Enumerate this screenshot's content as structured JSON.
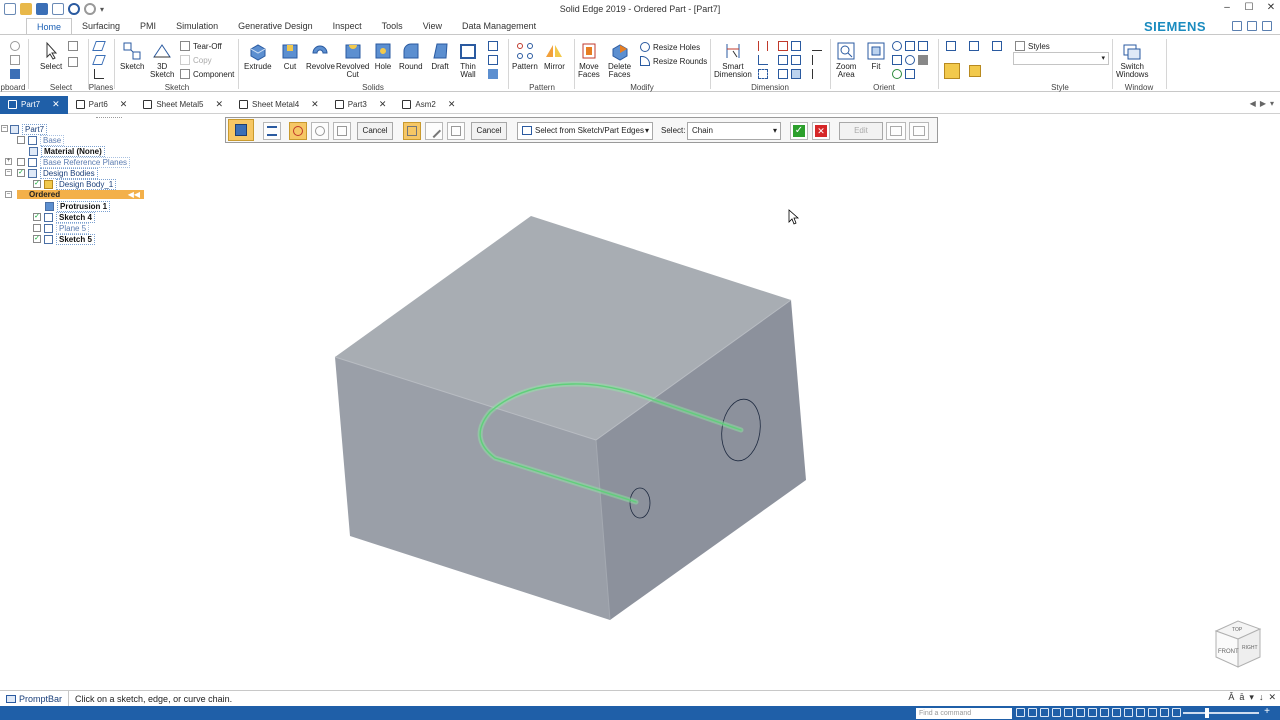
{
  "window": {
    "title": "Solid Edge 2019 - Ordered Part - [Part7]",
    "brand": "SIEMENS",
    "controls": [
      "–",
      "☐",
      "✕"
    ]
  },
  "ribbon_tabs": [
    {
      "label": "Home",
      "active": true
    },
    {
      "label": "Surfacing"
    },
    {
      "label": "PMI"
    },
    {
      "label": "Simulation"
    },
    {
      "label": "Generative Design"
    },
    {
      "label": "Inspect"
    },
    {
      "label": "Tools"
    },
    {
      "label": "View"
    },
    {
      "label": "Data Management"
    }
  ],
  "ribbon": {
    "clipboard_group": "pboard",
    "select": {
      "label": "Select",
      "group": "Select"
    },
    "planes_group": "Planes",
    "sketch": {
      "sketch": "Sketch",
      "sketch3d_1": "3D",
      "sketch3d_2": "Sketch",
      "tearoff": "Tear-Off",
      "copy": "Copy",
      "component": "Component",
      "group": "Sketch"
    },
    "solids": {
      "extrude": "Extrude",
      "cut": "Cut",
      "revolve": "Revolve",
      "revolved_cut_1": "Revolved",
      "revolved_cut_2": "Cut",
      "hole": "Hole",
      "round": "Round",
      "draft": "Draft",
      "thin_wall_1": "Thin",
      "thin_wall_2": "Wall",
      "group": "Solids"
    },
    "pattern": {
      "pattern": "Pattern",
      "mirror": "Mirror",
      "group": "Pattern"
    },
    "modify": {
      "move_faces_1": "Move",
      "move_faces_2": "Faces",
      "delete_faces_1": "Delete",
      "delete_faces_2": "Faces",
      "resize_holes": "Resize Holes",
      "resize_rounds": "Resize Rounds",
      "group": "Modify"
    },
    "dimension": {
      "smart_1": "Smart",
      "smart_2": "Dimension",
      "group": "Dimension"
    },
    "orient": {
      "zoom_area_1": "Zoom",
      "zoom_area_2": "Area",
      "fit": "Fit",
      "group": "Orient"
    },
    "style": {
      "styles": "Styles",
      "group": "Style"
    },
    "window_group": {
      "switch_1": "Switch",
      "switch_2": "Windows",
      "group": "Window"
    }
  },
  "doc_tabs": [
    {
      "label": "Part7",
      "active": true
    },
    {
      "label": "Part6"
    },
    {
      "label": "Sheet Metal5"
    },
    {
      "label": "Sheet Metal4"
    },
    {
      "label": "Part3"
    },
    {
      "label": "Asm2"
    }
  ],
  "command_bar": {
    "cancel1": "Cancel",
    "cancel2": "Cancel",
    "select_from": "Select from Sketch/Part Edges",
    "select_label": "Select:",
    "select_value": "Chain",
    "edit": "Edit"
  },
  "tree": {
    "root": "Part7",
    "base": "Base",
    "material": "Material (None)",
    "base_planes": "Base Reference Planes",
    "design_bodies": "Design Bodies",
    "design_body_1": "Design Body_1",
    "ordered": "Ordered",
    "protrusion1": "Protrusion 1",
    "sketch4": "Sketch 4",
    "plane5": "Plane 5",
    "sketch5": "Sketch 5"
  },
  "promptbar": {
    "label": "PromptBar",
    "text": "Click on a sketch, edge, or curve chain."
  },
  "status": {
    "find_placeholder": "Find a command"
  },
  "viewcube": {
    "front": "FRONT",
    "right": "RIGHT",
    "top": "TOP"
  },
  "colors": {
    "accent": "#1f5fa8",
    "brand": "#1a8bbf",
    "ordered_highlight": "#f3b04a",
    "top_face": "#a8adb3",
    "front_face": "#9a9fa8",
    "right_face": "#8c919c",
    "selected_curve": "#5fd07a"
  }
}
